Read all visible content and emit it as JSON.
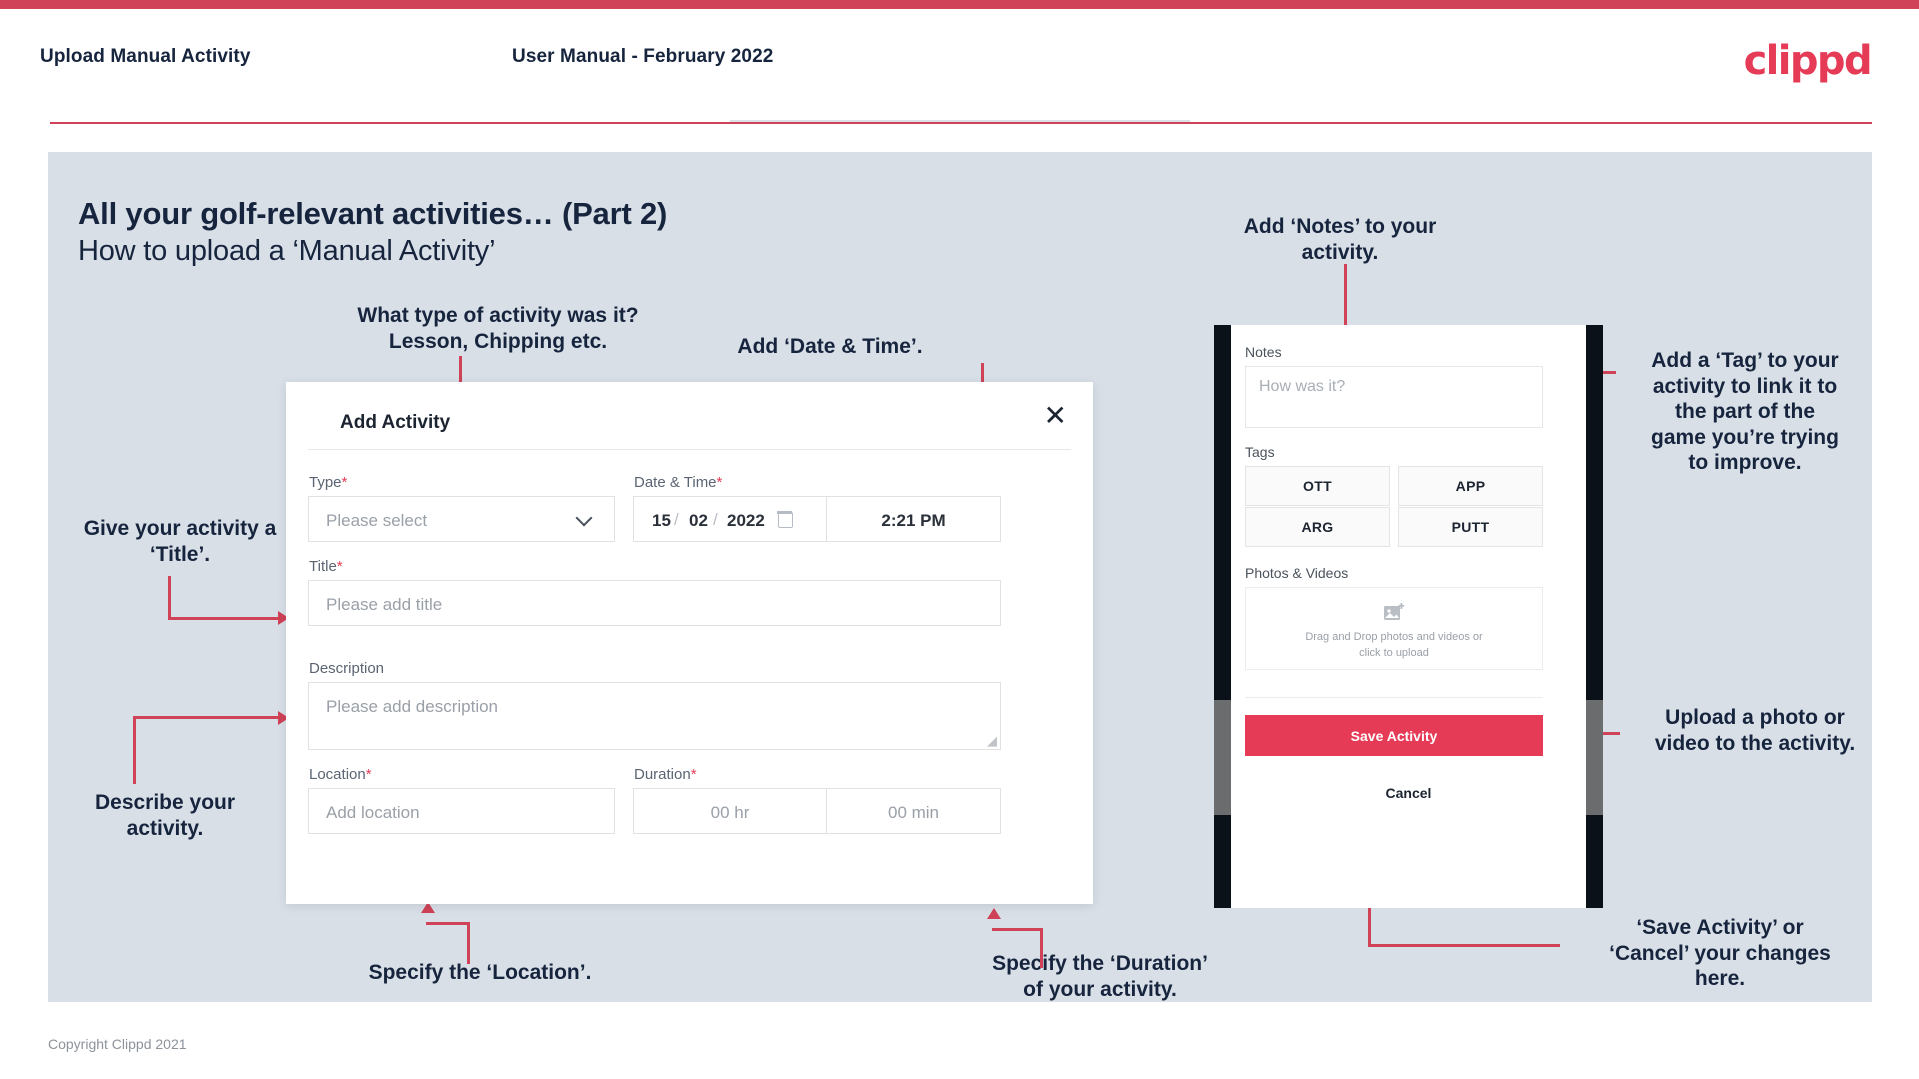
{
  "header": {
    "left_title": "Upload Manual Activity",
    "center_title": "User Manual - February 2022",
    "logo": "clippd"
  },
  "slide": {
    "title_line1": "All your golf-relevant activities… (Part 2)",
    "title_line2": "How to upload a ‘Manual Activity’"
  },
  "annotations": {
    "type": "What type of activity was it?\nLesson, Chipping etc.",
    "type_l1": "What type of activity was it?",
    "type_l2": "Lesson, Chipping etc.",
    "datetime": "Add ‘Date & Time’.",
    "notes_l1": "Add ‘Notes’ to your",
    "notes_l2": "activity.",
    "title_l1": "Give your activity a",
    "title_l2": "‘Title’.",
    "describe_l1": "Describe your",
    "describe_l2": "activity.",
    "location": "Specify the ‘Location’.",
    "duration_l1": "Specify the ‘Duration’",
    "duration_l2": "of your activity.",
    "tag_l1": "Add a ‘Tag’ to your",
    "tag_l2": "activity to link it to",
    "tag_l3": "the part of the",
    "tag_l4": "game you’re trying",
    "tag_l5": "to improve.",
    "upload_l1": "Upload a photo or",
    "upload_l2": "video to the activity.",
    "save_l1": "‘Save Activity’ or",
    "save_l2": "‘Cancel’ your changes",
    "save_l3": "here."
  },
  "modal": {
    "title": "Add Activity",
    "close_icon": "✕",
    "type_label": "Type",
    "type_placeholder": "Please select",
    "datetime_label": "Date & Time",
    "date_day": "15",
    "date_sep1": "/",
    "date_month": "02",
    "date_sep2": "/",
    "date_year": "2022",
    "time_value": "2:21 PM",
    "title_label": "Title",
    "title_placeholder": "Please add title",
    "description_label": "Description",
    "description_placeholder": "Please add description",
    "location_label": "Location",
    "location_placeholder": "Add location",
    "duration_label": "Duration",
    "duration_hr_placeholder": "00 hr",
    "duration_min_placeholder": "00 min",
    "required_mark": "*"
  },
  "phone": {
    "notes_label": "Notes",
    "notes_placeholder": "How was it?",
    "tags_label": "Tags",
    "tags": [
      "OTT",
      "APP",
      "ARG",
      "PUTT"
    ],
    "photos_label": "Photos & Videos",
    "dropzone_l1": "Drag and Drop photos and videos or",
    "dropzone_l2": "click to upload",
    "save_label": "Save Activity",
    "cancel_label": "Cancel"
  },
  "footer": {
    "copyright": "Copyright Clippd 2021"
  },
  "colors": {
    "brand_pink": "#e63b56",
    "accent_line": "#cf4257",
    "slide_bg": "#d8dfe7",
    "text_dark": "#16243d"
  }
}
